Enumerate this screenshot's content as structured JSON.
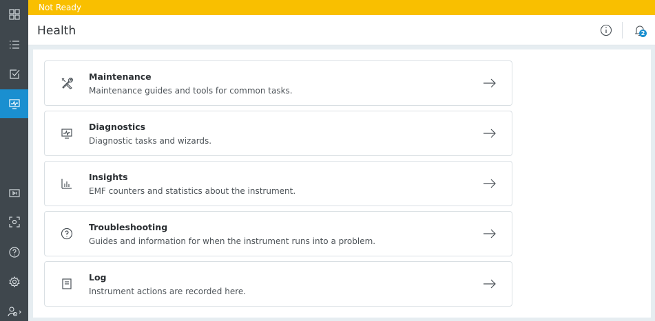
{
  "status": {
    "text": "Not Ready"
  },
  "header": {
    "title": "Health",
    "notification_count": "2"
  },
  "rail": {
    "items": [
      {
        "icon": "dashboard-grid-icon"
      },
      {
        "icon": "list-icon"
      },
      {
        "icon": "checkbox-icon"
      },
      {
        "icon": "health-monitor-icon",
        "active": true
      },
      {
        "icon": "media-player-icon"
      },
      {
        "icon": "camera-focus-icon"
      },
      {
        "icon": "help-icon"
      },
      {
        "icon": "settings-icon"
      },
      {
        "icon": "user-settings-icon"
      }
    ]
  },
  "cards": [
    {
      "title": "Maintenance",
      "description": "Maintenance guides and tools for common tasks.",
      "icon": "tools-icon"
    },
    {
      "title": "Diagnostics",
      "description": "Diagnostic tasks and wizards.",
      "icon": "monitor-pulse-icon"
    },
    {
      "title": "Insights",
      "description": "EMF counters and statistics about the instrument.",
      "icon": "bar-chart-icon"
    },
    {
      "title": "Troubleshooting",
      "description": "Guides and information for when the instrument runs into a problem.",
      "icon": "question-icon"
    },
    {
      "title": "Log",
      "description": "Instrument actions are recorded here.",
      "icon": "document-icon"
    }
  ],
  "colors": {
    "accent": "#1a8fd0",
    "status_warning": "#f9bf00",
    "rail": "#3f474d"
  }
}
